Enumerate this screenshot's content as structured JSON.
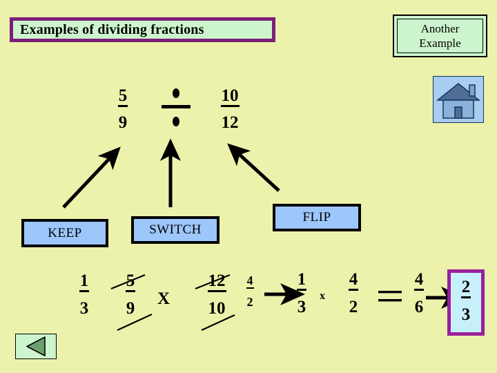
{
  "page": {
    "background_color": "#ecf2ab"
  },
  "title": {
    "text": "Examples of dividing fractions",
    "border_color": "#7b1f7b",
    "fill_color": "#cdf5cd"
  },
  "another_example": {
    "line1": "Another",
    "line2": "Example",
    "fill_color": "#cdf5cd"
  },
  "home_button": {
    "icon": "home-icon",
    "fill_color": "#a8cdf0"
  },
  "back_button": {
    "icon": "back-triangle-icon",
    "fill_color": "#cdf5cd"
  },
  "problem": {
    "left_fraction": {
      "numerator": "5",
      "denominator": "9"
    },
    "operator": "÷",
    "right_fraction": {
      "numerator": "10",
      "denominator": "12"
    }
  },
  "steps": {
    "keep": "KEEP",
    "switch": "SWITCH",
    "flip": "FLIP",
    "box_fill": "#9dc6fa"
  },
  "working": {
    "reduced_first": {
      "numerator": "1",
      "denominator": "3"
    },
    "cancelled_first": {
      "numerator": "5",
      "denominator": "9"
    },
    "multiply_symbol_1": "X",
    "cancelled_second": {
      "numerator": "12",
      "denominator": "10"
    },
    "reduced_second": {
      "numerator": "4",
      "denominator": "2"
    },
    "arrow_1": "→",
    "restated_first": {
      "numerator": "1",
      "denominator": "3"
    },
    "multiply_symbol_2": "x",
    "restated_second": {
      "numerator": "4",
      "denominator": "2"
    },
    "equals_symbol": "=",
    "product": {
      "numerator": "4",
      "denominator": "6"
    },
    "arrow_2": "→",
    "answer": {
      "numerator": "2",
      "denominator": "3"
    },
    "answer_box_border": "#9b1f9b",
    "answer_box_fill": "#c8f0fb"
  }
}
